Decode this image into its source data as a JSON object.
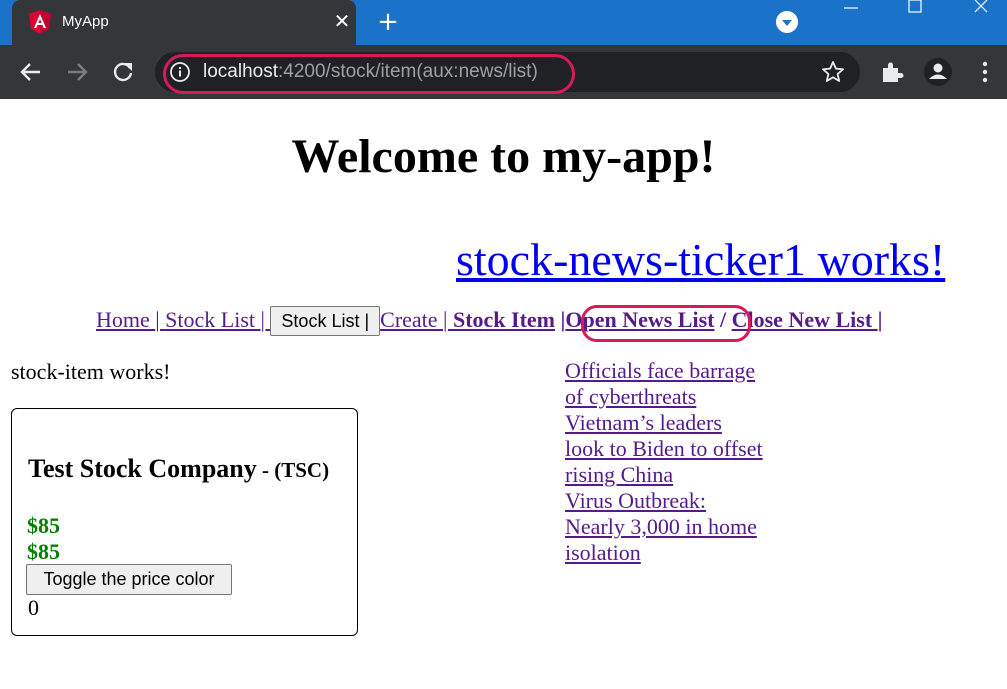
{
  "browser": {
    "tab_title": "MyApp",
    "url_host": "localhost",
    "url_rest": ":4200/stock/item(aux:news/list)",
    "new_tab_glyph": "+",
    "close_glyph": "✕",
    "accent_color": "#1a73c8",
    "highlight_color": "#d81b57"
  },
  "page": {
    "welcome": "Welcome to my-app!",
    "ticker": "stock-news-ticker1 works!",
    "stock_item_works": "stock-item works!"
  },
  "nav": {
    "home": "Home ",
    "sep1": "| ",
    "stock_list_link": "Stock List ",
    "sep2": "| ",
    "stock_list_button": "Stock List |",
    "create": "Create ",
    "sep3": "| ",
    "stock_item": "Stock Item",
    "sep4": " |",
    "open_news": "Open News List",
    "sep5": " / ",
    "close_news": "Close New List ",
    "sep6": "|"
  },
  "stock": {
    "name": "Test Stock Company",
    "code": " - (TSC)",
    "price1": "$85",
    "price2": "$85",
    "toggle_label": "Toggle the price color",
    "counter": "0",
    "price_color": "#008000"
  },
  "news": {
    "items": [
      "Officials face barrage of cyberthreats",
      "Vietnam’s leaders look to Biden to offset rising China",
      "Virus Outbreak: Nearly 3,000 in home isolation"
    ]
  }
}
